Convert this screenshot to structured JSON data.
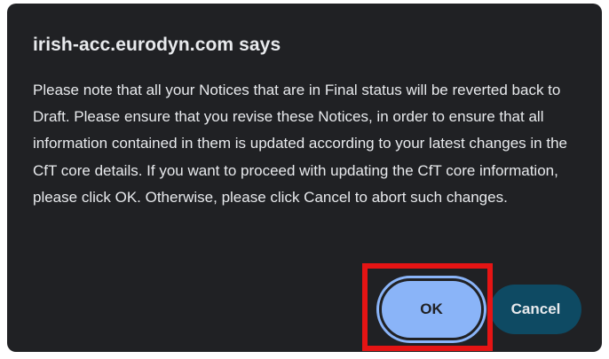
{
  "dialog": {
    "title": "irish-acc.eurodyn.com says",
    "message": "Please note that all your Notices that are in Final status will be reverted back to Draft. Please ensure that you revise these Notices, in order to ensure that all information contained in them is updated according to your latest changes in the CfT core details. If you want to proceed with updating the CfT core information, please click OK. Otherwise, please click Cancel to abort such changes.",
    "ok_label": "OK",
    "cancel_label": "Cancel"
  },
  "colors": {
    "dialog_background": "#202124",
    "text": "#e8eaed",
    "ok_button": "#8ab4f8",
    "cancel_button": "#0e4a63",
    "highlight": "#e51414"
  }
}
